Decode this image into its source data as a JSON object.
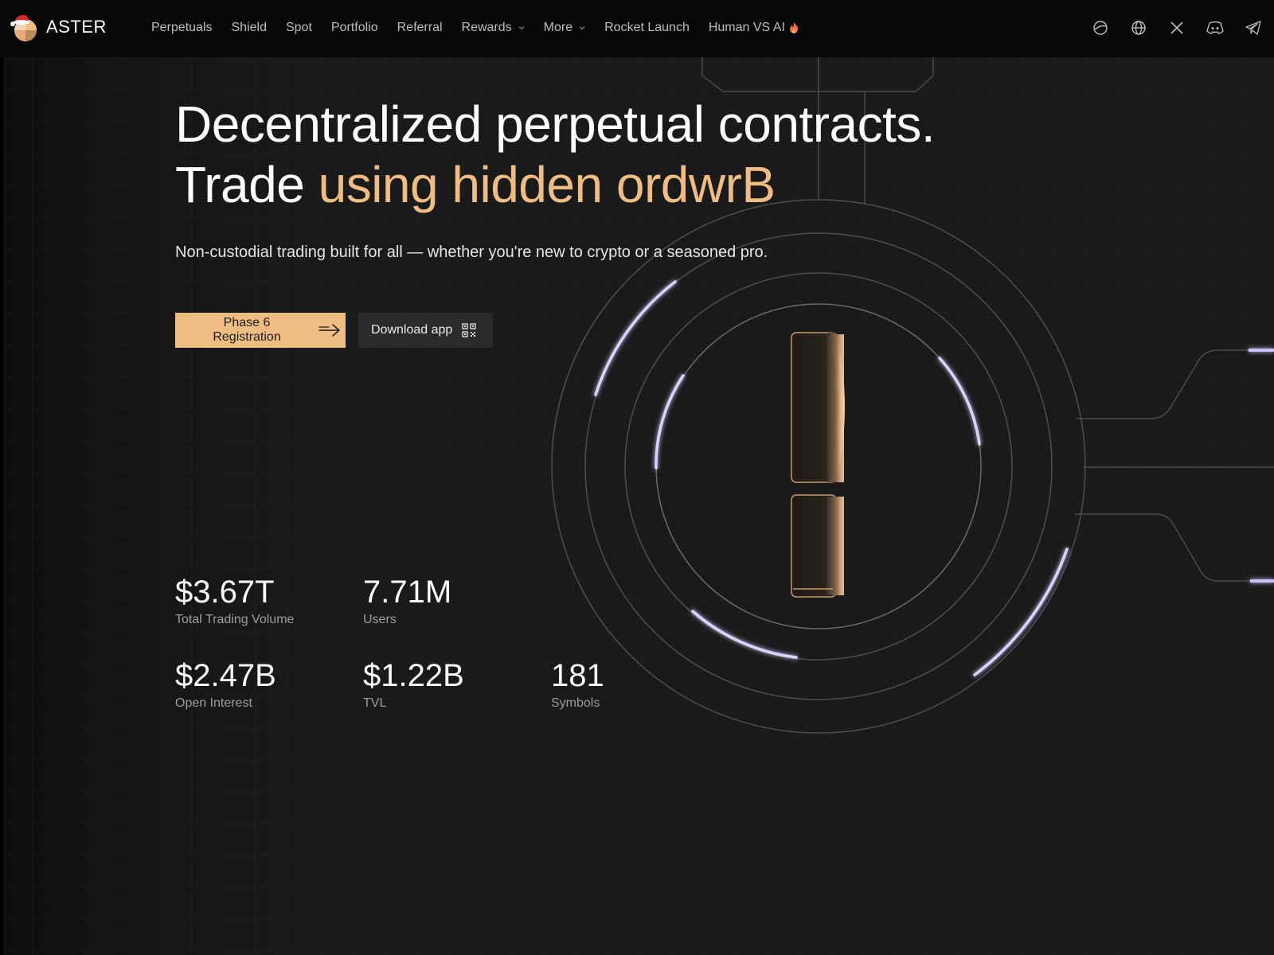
{
  "brand": {
    "name": "ASTER",
    "logo_icon": "aster-logo-with-santa-hat-icon"
  },
  "nav": {
    "items": [
      {
        "label": "Perpetuals"
      },
      {
        "label": "Shield"
      },
      {
        "label": "Spot"
      },
      {
        "label": "Portfolio"
      },
      {
        "label": "Referral"
      },
      {
        "label": "Rewards",
        "has_dropdown": true
      },
      {
        "label": "More",
        "has_dropdown": true
      },
      {
        "label": "Rocket Launch"
      },
      {
        "label": "Human VS AI",
        "badge_icon": "flame-icon"
      }
    ],
    "socials": [
      "theme-toggle-icon",
      "globe-icon",
      "x-twitter-icon",
      "discord-icon",
      "telegram-icon"
    ]
  },
  "hero": {
    "title_line1": "Decentralized perpetual contracts.",
    "title_line2_plain": "Trade ",
    "title_line2_accent": "using hidden ordwrB",
    "subtitle": "Non-custodial trading built for all — whether you're new to crypto or a seasoned pro."
  },
  "buttons": {
    "primary_label": "Phase 6 Registration",
    "primary_icon": "arrow-right-icon",
    "secondary_label": "Download app",
    "secondary_icon": "qr-code-icon"
  },
  "stats": [
    {
      "value": "$3.67T",
      "label": "Total Trading Volume"
    },
    {
      "value": "7.71M",
      "label": "Users"
    },
    {
      "value": "$2.47B",
      "label": "Open Interest"
    },
    {
      "value": "$1.22B",
      "label": "TVL"
    },
    {
      "value": "181",
      "label": "Symbols"
    }
  ],
  "colors": {
    "accent": "#efbc82",
    "background": "#1a1a1b",
    "nav_background": "#070707",
    "ring_highlight": "#c8c2ff",
    "flame": "#ff6a3d"
  }
}
